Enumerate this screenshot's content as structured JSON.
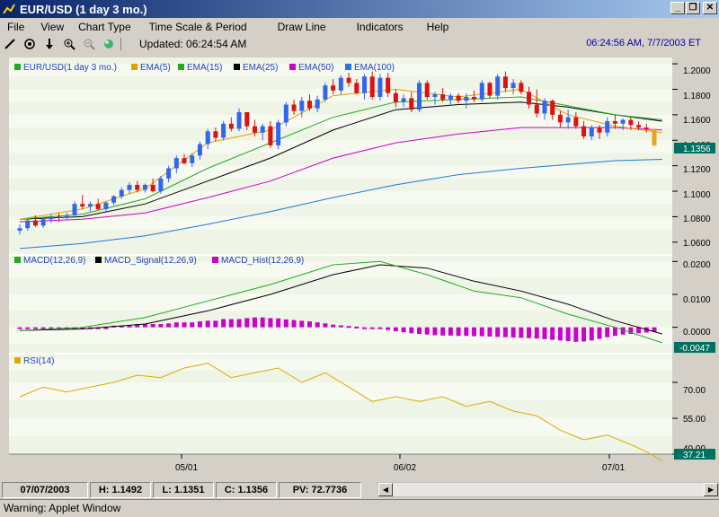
{
  "window": {
    "title": "EUR/USD (1 day  3 mo.)"
  },
  "menu": [
    "File",
    "View",
    "Chart Type",
    "Time Scale & Period",
    "Draw Line",
    "Indicators",
    "Help"
  ],
  "toolbar": {
    "updated": "Updated: 06:24:54 AM",
    "clock": "06:24:56 AM, 7/7/2003 ET"
  },
  "colors": {
    "ema5": "#e0a000",
    "ema15": "#22aa22",
    "ema25": "#000000",
    "ema50": "#cc00cc",
    "ema100": "#2277dd",
    "up": "#3366ee",
    "down": "#dd1111",
    "last": "#f0a020",
    "rsi": "#ddaa00"
  },
  "legend_price": [
    "EUR/USD(1 day  3 mo.)",
    "EMA(5)",
    "EMA(15)",
    "EMA(25)",
    "EMA(50)",
    "EMA(100)"
  ],
  "legend_macd": [
    "MACD(12,26,9)",
    "MACD_Signal(12,26,9)",
    "MACD_Hist(12,26,9)"
  ],
  "legend_rsi": [
    "RSI(14)"
  ],
  "price_axis": [
    "1.2000",
    "1.1800",
    "1.1600",
    "1.1400",
    "1.1200",
    "1.1000",
    "1.0800",
    "1.0600"
  ],
  "price_last": "1.1356",
  "macd_axis": [
    "0.0200",
    "0.0100",
    "0.0000"
  ],
  "macd_last": "-0.0047",
  "rsi_axis": [
    "70.00",
    "55.00",
    "40.00"
  ],
  "rsi_last": "37.21",
  "x_labels": [
    "05/01",
    "06/02",
    "07/01"
  ],
  "status": {
    "date": "07/07/2003",
    "high": "H: 1.1492",
    "low": "L: 1.1351",
    "close": "C: 1.1356",
    "pv": "PV: 72.7736"
  },
  "warning": "Warning: Applet Window",
  "chart_data": [
    {
      "type": "candlestick",
      "title": "EUR/USD(1 day  3 mo.)",
      "ylim": [
        1.05,
        1.205
      ],
      "candles": [
        [
          1.069,
          1.074,
          1.066,
          1.071
        ],
        [
          1.071,
          1.078,
          1.069,
          1.077
        ],
        [
          1.077,
          1.081,
          1.072,
          1.073
        ],
        [
          1.073,
          1.079,
          1.071,
          1.078
        ],
        [
          1.078,
          1.082,
          1.075,
          1.08
        ],
        [
          1.08,
          1.083,
          1.076,
          1.079
        ],
        [
          1.079,
          1.083,
          1.077,
          1.081
        ],
        [
          1.081,
          1.092,
          1.08,
          1.09
        ],
        [
          1.09,
          1.097,
          1.086,
          1.088
        ],
        [
          1.088,
          1.092,
          1.084,
          1.09
        ],
        [
          1.09,
          1.094,
          1.085,
          1.086
        ],
        [
          1.086,
          1.092,
          1.083,
          1.091
        ],
        [
          1.091,
          1.097,
          1.089,
          1.096
        ],
        [
          1.096,
          1.103,
          1.094,
          1.101
        ],
        [
          1.101,
          1.107,
          1.098,
          1.105
        ],
        [
          1.105,
          1.108,
          1.099,
          1.101
        ],
        [
          1.101,
          1.106,
          1.099,
          1.105
        ],
        [
          1.105,
          1.11,
          1.099,
          1.1
        ],
        [
          1.1,
          1.112,
          1.098,
          1.11
        ],
        [
          1.11,
          1.12,
          1.107,
          1.118
        ],
        [
          1.118,
          1.128,
          1.114,
          1.126
        ],
        [
          1.126,
          1.129,
          1.121,
          1.122
        ],
        [
          1.122,
          1.13,
          1.119,
          1.128
        ],
        [
          1.128,
          1.139,
          1.125,
          1.137
        ],
        [
          1.137,
          1.149,
          1.133,
          1.147
        ],
        [
          1.147,
          1.15,
          1.139,
          1.142
        ],
        [
          1.142,
          1.155,
          1.14,
          1.153
        ],
        [
          1.153,
          1.158,
          1.147,
          1.149
        ],
        [
          1.149,
          1.165,
          1.147,
          1.162
        ],
        [
          1.162,
          1.162,
          1.148,
          1.151
        ],
        [
          1.151,
          1.156,
          1.143,
          1.146
        ],
        [
          1.146,
          1.153,
          1.14,
          1.151
        ],
        [
          1.151,
          1.155,
          1.134,
          1.136
        ],
        [
          1.136,
          1.156,
          1.133,
          1.154
        ],
        [
          1.154,
          1.17,
          1.151,
          1.168
        ],
        [
          1.168,
          1.172,
          1.16,
          1.163
        ],
        [
          1.163,
          1.174,
          1.158,
          1.171
        ],
        [
          1.171,
          1.176,
          1.163,
          1.165
        ],
        [
          1.165,
          1.175,
          1.162,
          1.172
        ],
        [
          1.172,
          1.185,
          1.17,
          1.183
        ],
        [
          1.183,
          1.188,
          1.176,
          1.179
        ],
        [
          1.179,
          1.191,
          1.176,
          1.189
        ],
        [
          1.189,
          1.193,
          1.182,
          1.185
        ],
        [
          1.185,
          1.188,
          1.176,
          1.177
        ],
        [
          1.177,
          1.192,
          1.172,
          1.19
        ],
        [
          1.19,
          1.194,
          1.172,
          1.174
        ],
        [
          1.174,
          1.192,
          1.171,
          1.189
        ],
        [
          1.189,
          1.193,
          1.174,
          1.177
        ],
        [
          1.177,
          1.18,
          1.166,
          1.17
        ],
        [
          1.17,
          1.176,
          1.166,
          1.173
        ],
        [
          1.173,
          1.178,
          1.162,
          1.164
        ],
        [
          1.164,
          1.187,
          1.162,
          1.185
        ],
        [
          1.185,
          1.187,
          1.172,
          1.174
        ],
        [
          1.174,
          1.178,
          1.168,
          1.176
        ],
        [
          1.176,
          1.181,
          1.17,
          1.172
        ],
        [
          1.172,
          1.177,
          1.167,
          1.175
        ],
        [
          1.175,
          1.177,
          1.169,
          1.171
        ],
        [
          1.171,
          1.177,
          1.165,
          1.174
        ],
        [
          1.174,
          1.179,
          1.17,
          1.172
        ],
        [
          1.172,
          1.187,
          1.17,
          1.185
        ],
        [
          1.185,
          1.186,
          1.173,
          1.175
        ],
        [
          1.175,
          1.192,
          1.172,
          1.19
        ],
        [
          1.19,
          1.194,
          1.178,
          1.181
        ],
        [
          1.181,
          1.188,
          1.176,
          1.185
        ],
        [
          1.185,
          1.187,
          1.176,
          1.178
        ],
        [
          1.178,
          1.182,
          1.165,
          1.168
        ],
        [
          1.168,
          1.18,
          1.158,
          1.161
        ],
        [
          1.161,
          1.173,
          1.156,
          1.171
        ],
        [
          1.171,
          1.172,
          1.156,
          1.16
        ],
        [
          1.16,
          1.163,
          1.15,
          1.154
        ],
        [
          1.154,
          1.164,
          1.149,
          1.158
        ],
        [
          1.158,
          1.162,
          1.149,
          1.151
        ],
        [
          1.151,
          1.155,
          1.141,
          1.143
        ],
        [
          1.143,
          1.152,
          1.14,
          1.15
        ],
        [
          1.15,
          1.152,
          1.141,
          1.146
        ],
        [
          1.146,
          1.158,
          1.143,
          1.155
        ],
        [
          1.155,
          1.16,
          1.149,
          1.153
        ],
        [
          1.153,
          1.157,
          1.148,
          1.156
        ],
        [
          1.156,
          1.158,
          1.148,
          1.152
        ],
        [
          1.152,
          1.155,
          1.148,
          1.15
        ],
        [
          1.15,
          1.153,
          1.146,
          1.149
        ],
        [
          1.149,
          1.149,
          1.135,
          1.136
        ]
      ],
      "ema": {
        "ema5": [
          [
            0,
            1.078
          ],
          [
            8,
            1.086
          ],
          [
            16,
            1.102
          ],
          [
            24,
            1.138
          ],
          [
            32,
            1.148
          ],
          [
            40,
            1.175
          ],
          [
            48,
            1.18
          ],
          [
            56,
            1.174
          ],
          [
            64,
            1.18
          ],
          [
            70,
            1.16
          ],
          [
            76,
            1.151
          ],
          [
            82,
            1.146
          ]
        ],
        "ema15": [
          [
            0,
            1.078
          ],
          [
            8,
            1.082
          ],
          [
            16,
            1.094
          ],
          [
            24,
            1.118
          ],
          [
            32,
            1.138
          ],
          [
            40,
            1.158
          ],
          [
            48,
            1.17
          ],
          [
            56,
            1.172
          ],
          [
            64,
            1.174
          ],
          [
            70,
            1.167
          ],
          [
            76,
            1.16
          ],
          [
            82,
            1.156
          ]
        ],
        "ema25": [
          [
            0,
            1.078
          ],
          [
            8,
            1.08
          ],
          [
            16,
            1.09
          ],
          [
            24,
            1.108
          ],
          [
            32,
            1.126
          ],
          [
            40,
            1.148
          ],
          [
            48,
            1.164
          ],
          [
            56,
            1.168
          ],
          [
            64,
            1.17
          ],
          [
            70,
            1.166
          ],
          [
            76,
            1.16
          ],
          [
            82,
            1.155
          ]
        ],
        "ema50": [
          [
            0,
            1.076
          ],
          [
            8,
            1.078
          ],
          [
            16,
            1.083
          ],
          [
            24,
            1.095
          ],
          [
            32,
            1.108
          ],
          [
            40,
            1.126
          ],
          [
            48,
            1.138
          ],
          [
            56,
            1.145
          ],
          [
            64,
            1.15
          ],
          [
            70,
            1.15
          ],
          [
            76,
            1.15
          ],
          [
            82,
            1.148
          ]
        ],
        "ema100": [
          [
            0,
            1.055
          ],
          [
            8,
            1.059
          ],
          [
            16,
            1.065
          ],
          [
            24,
            1.074
          ],
          [
            32,
            1.084
          ],
          [
            40,
            1.095
          ],
          [
            48,
            1.105
          ],
          [
            56,
            1.113
          ],
          [
            64,
            1.118
          ],
          [
            70,
            1.121
          ],
          [
            76,
            1.124
          ],
          [
            82,
            1.125
          ]
        ]
      }
    },
    {
      "type": "line",
      "title": "MACD(12,26,9)",
      "ylim": [
        -0.008,
        0.022
      ],
      "macd": [
        [
          0,
          -0.001
        ],
        [
          8,
          0.0
        ],
        [
          16,
          0.003
        ],
        [
          24,
          0.008
        ],
        [
          32,
          0.013
        ],
        [
          40,
          0.019
        ],
        [
          46,
          0.02
        ],
        [
          52,
          0.016
        ],
        [
          58,
          0.011
        ],
        [
          64,
          0.009
        ],
        [
          70,
          0.004
        ],
        [
          76,
          0.0
        ],
        [
          82,
          -0.0047
        ]
      ],
      "signal": [
        [
          0,
          -0.001
        ],
        [
          8,
          -0.0005
        ],
        [
          16,
          0.001
        ],
        [
          24,
          0.005
        ],
        [
          32,
          0.01
        ],
        [
          40,
          0.016
        ],
        [
          46,
          0.019
        ],
        [
          52,
          0.018
        ],
        [
          58,
          0.014
        ],
        [
          64,
          0.011
        ],
        [
          70,
          0.007
        ],
        [
          76,
          0.002
        ],
        [
          82,
          -0.002
        ]
      ],
      "hist": [
        0.0,
        0.0,
        0.0,
        0.0,
        0.0,
        0.0,
        0.0,
        0.0,
        0.0,
        0.0,
        0.0,
        0.0,
        0.0005,
        0.0005,
        0.0005,
        0.001,
        0.001,
        0.001,
        0.001,
        0.0012,
        0.0015,
        0.0015,
        0.0015,
        0.0018,
        0.002,
        0.002,
        0.0025,
        0.0025,
        0.0025,
        0.0028,
        0.003,
        0.003,
        0.0028,
        0.0027,
        0.0024,
        0.0022,
        0.002,
        0.0018,
        0.0015,
        0.0012,
        0.0008,
        0.0006,
        0.0004,
        0.0002,
        0.0,
        -0.0002,
        -0.0005,
        -0.0008,
        -0.0012,
        -0.0015,
        -0.0018,
        -0.002,
        -0.0022,
        -0.0024,
        -0.0025,
        -0.0025,
        -0.0026,
        -0.0026,
        -0.0027,
        -0.0027,
        -0.0028,
        -0.0029,
        -0.003,
        -0.0031,
        -0.0032,
        -0.0033,
        -0.0034,
        -0.0036,
        -0.0038,
        -0.004,
        -0.0042,
        -0.0044,
        -0.0043,
        -0.004,
        -0.0035,
        -0.003,
        -0.0026,
        -0.0022,
        -0.002,
        -0.0018,
        -0.0016,
        -0.0014
      ]
    },
    {
      "type": "line",
      "title": "RSI(14)",
      "ylim": [
        40,
        82
      ],
      "values": [
        [
          0,
          64
        ],
        [
          3,
          68
        ],
        [
          6,
          66
        ],
        [
          9,
          68
        ],
        [
          12,
          70
        ],
        [
          15,
          73
        ],
        [
          18,
          72
        ],
        [
          21,
          76
        ],
        [
          24,
          78
        ],
        [
          27,
          72
        ],
        [
          30,
          74
        ],
        [
          33,
          76
        ],
        [
          36,
          70
        ],
        [
          39,
          74
        ],
        [
          42,
          68
        ],
        [
          45,
          62
        ],
        [
          48,
          64
        ],
        [
          51,
          62
        ],
        [
          54,
          64
        ],
        [
          57,
          60
        ],
        [
          60,
          62
        ],
        [
          63,
          58
        ],
        [
          66,
          56
        ],
        [
          69,
          50
        ],
        [
          72,
          46
        ],
        [
          75,
          48
        ],
        [
          78,
          44
        ],
        [
          80,
          41
        ],
        [
          82,
          37.21
        ]
      ]
    }
  ]
}
